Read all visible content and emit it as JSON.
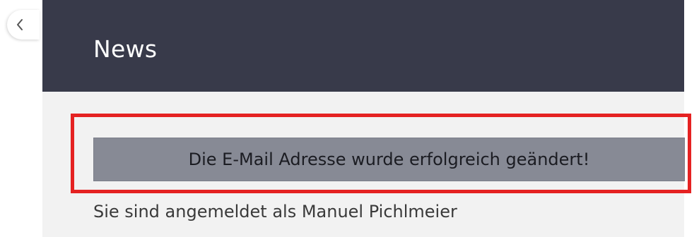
{
  "navigation": {
    "back_icon": "chevron-left-icon"
  },
  "panel": {
    "title": "News"
  },
  "alert": {
    "message": "Die E-Mail Adresse wurde erfolgreich geändert!"
  },
  "user": {
    "login_status": "Sie sind angemeldet als Manuel Pichlmeier"
  },
  "colors": {
    "header_background": "#383a4a",
    "panel_background": "#f2f2f2",
    "alert_background": "#878a95",
    "highlight_border": "#e52222"
  }
}
